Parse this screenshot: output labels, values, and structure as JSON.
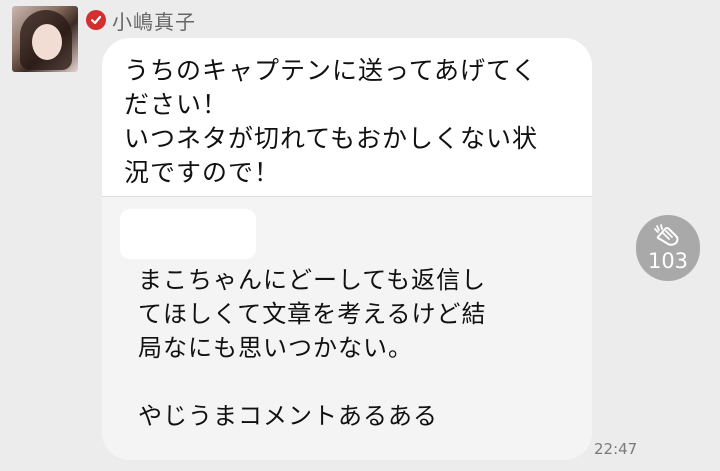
{
  "sender": {
    "name": "小嶋真子"
  },
  "message": {
    "text": "うちのキャプテンに送ってあげてく\nださい！\nいつネタが切れてもおかしくない状\n況ですので！",
    "quote": {
      "text": "まこちゃんにどーしても返信し\nてほしくて文章を考えるけど結\n局なにも思いつかない。\n\nやじうまコメントあるある"
    },
    "time": "22:47"
  },
  "like": {
    "icon": "clap-icon",
    "count": "103"
  }
}
